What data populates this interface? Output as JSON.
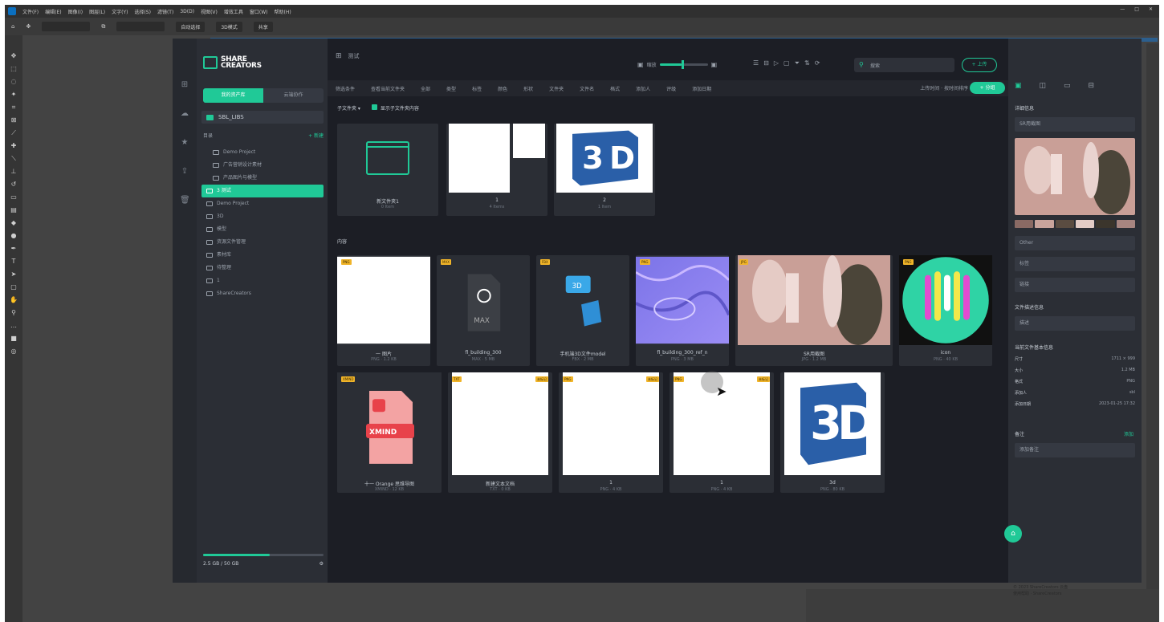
{
  "photoshop": {
    "menu": [
      "文件(F)",
      "编辑(E)",
      "图像(I)",
      "图层(L)",
      "文字(Y)",
      "选择(S)",
      "滤镜(T)",
      "3D(D)",
      "视图(V)",
      "增效工具",
      "窗口(W)",
      "帮助(H)"
    ],
    "options": {
      "mode": "自动选择",
      "align_label": "3D模式",
      "btn_label": "共享"
    }
  },
  "app": {
    "logo_line1": "SHARE",
    "logo_line2": "CREATORS",
    "sidebar_tabs": [
      "我的资产库",
      "云端协作"
    ],
    "library_name": "SBL_LIBS",
    "section_title": "目录",
    "section_add": "+ 新建",
    "tree": [
      {
        "label": "Demo Project",
        "active": false
      },
      {
        "label": "广告营销设计素材",
        "active": false
      },
      {
        "label": "产品图片与模型",
        "active": false
      },
      {
        "label": "3 测试",
        "active": true
      },
      {
        "label": "Demo Project",
        "active": false
      },
      {
        "label": "3D",
        "active": false
      },
      {
        "label": "模型",
        "active": false
      },
      {
        "label": "资源文件管理",
        "active": false
      },
      {
        "label": "素材库",
        "active": false
      },
      {
        "label": "待整理",
        "active": false
      },
      {
        "label": "1",
        "active": false
      },
      {
        "label": "ShareCreators",
        "active": false
      }
    ],
    "storage_text": "2.5 GB / 50 GB",
    "breadcrumb": "测试",
    "zoom_label": "缩放",
    "zoom_value": 0.45,
    "search_placeholder": "搜索",
    "upload_label": "+ 上传",
    "filters": [
      "筛选条件",
      "查看当前文件夹",
      "全部",
      "类型",
      "标签",
      "颜色",
      "形状",
      "文件夹",
      "文件名",
      "格式",
      "添加人",
      "评级",
      "添加日期"
    ],
    "sort_info": "上传时间 · 按时间排序",
    "group_btn": "+ 分组",
    "subfolder_toggle": "子文件夹 ▾",
    "show_subfolder": "显示子文件夹内容",
    "files_label": "内容",
    "folders": [
      {
        "name": "新文件夹1",
        "meta": "0 Item",
        "kind": "folder"
      },
      {
        "name": "1",
        "meta": "4 Items",
        "kind": "white-split"
      },
      {
        "name": "2",
        "meta": "1 Item",
        "kind": "3d"
      }
    ],
    "row1": [
      {
        "name": "一 图片",
        "meta": "PNG · 1.2 KB",
        "badge": "PNG",
        "kind": "white"
      },
      {
        "name": "fl_building_300",
        "meta": "MAX · 5 MB",
        "badge": "MAX",
        "kind": "max"
      },
      {
        "name": "手机端3D文件model",
        "meta": "FBX · 2 MB",
        "badge": "FBX",
        "kind": "3dfile"
      },
      {
        "name": "fl_building_300_ref_n",
        "meta": "PNG · 3 MB",
        "badge": "PNG",
        "kind": "normal"
      },
      {
        "name": "SR用截图",
        "meta": "JPG · 1.2 MB",
        "badge": "JPG",
        "kind": "photo"
      },
      {
        "name": "icon",
        "meta": "PNG · 40 KB",
        "badge": "PNG",
        "kind": "logo"
      }
    ],
    "row2": [
      {
        "name": "十一 Orange 思维导图",
        "meta": "XMIND · 12 KB",
        "badge": "XMIND",
        "kind": "xmind"
      },
      {
        "name": "新建文本文档",
        "meta": "TXT · 0 KB",
        "badge": "TXT",
        "badge2": "未标记",
        "kind": "white"
      },
      {
        "name": "1",
        "meta": "PNG · 4 KB",
        "badge": "PNG",
        "badge2": "未标记",
        "kind": "white"
      },
      {
        "name": "1",
        "meta": "PNG · 4 KB",
        "badge": "PNG",
        "badge2": "未标记",
        "kind": "white"
      },
      {
        "name": "3d",
        "meta": "PNG · 80 KB",
        "badge": "",
        "kind": "3d"
      }
    ],
    "right": {
      "title": "详细信息",
      "name_field": "SR用截图",
      "category": "Other",
      "field_tag": "标签",
      "field_link": "链接",
      "desc_title": "文件描述信息",
      "desc_placeholder": "描述",
      "props_title": "当前文件基本信息",
      "props": [
        {
          "k": "尺寸",
          "v": "1711 × 999"
        },
        {
          "k": "大小",
          "v": "1.2 MB"
        },
        {
          "k": "格式",
          "v": "PNG"
        },
        {
          "k": "添加人",
          "v": "sbl"
        },
        {
          "k": "添加日期",
          "v": "2023-01-25 17:32"
        }
      ],
      "note_title": "备注",
      "note_action": "添加",
      "note_placeholder": "添加备注"
    },
    "footnote_line1": "© 2023 ShareCreators 云盘",
    "footnote_line2": "使用帮助 · ShareCreators"
  },
  "colors": {
    "accent": "#20c997",
    "bg": "#1c1e25",
    "panel": "#2b2e35"
  }
}
